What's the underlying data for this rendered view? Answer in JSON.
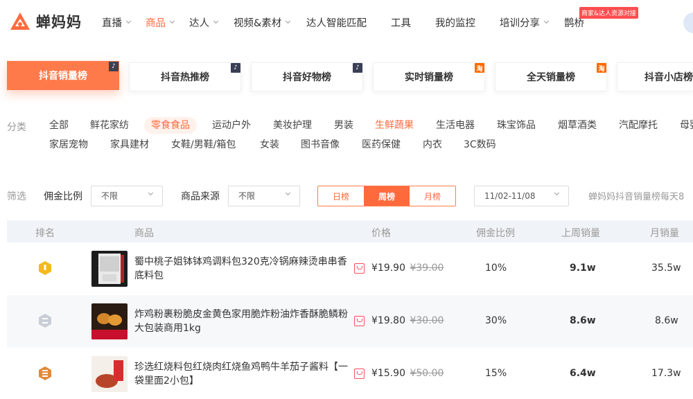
{
  "brand": {
    "name": "蝉妈妈",
    "color": "#ff6a3d"
  },
  "nav": {
    "items": [
      {
        "label": "直播",
        "dropdown": true
      },
      {
        "label": "商品",
        "dropdown": true,
        "active": true
      },
      {
        "label": "达人",
        "dropdown": true
      },
      {
        "label": "视频&素材",
        "dropdown": true
      },
      {
        "label": "达人智能匹配",
        "dropdown": false
      },
      {
        "label": "工具",
        "dropdown": false
      },
      {
        "label": "我的监控",
        "dropdown": false
      },
      {
        "label": "培训分享",
        "dropdown": true
      },
      {
        "label": "鹊桥",
        "dropdown": false
      }
    ],
    "badge": "商家&达人资源对接"
  },
  "rank_tabs": [
    {
      "label": "抖音销量榜",
      "platform": "douyin-icon",
      "active": true
    },
    {
      "label": "抖音热推榜",
      "platform": "douyin-icon"
    },
    {
      "label": "抖音好物榜",
      "platform": "douyin-icon"
    },
    {
      "label": "实时销量榜",
      "platform": "taobao-icon",
      "platform_text": "淘"
    },
    {
      "label": "全天销量榜",
      "platform": "taobao-icon",
      "platform_text": "淘"
    },
    {
      "label": "抖音小店榜",
      "platform": "none"
    }
  ],
  "categories": {
    "label": "分类",
    "items": [
      "全部",
      "鲜花家纺",
      "零食食品",
      "运动户外",
      "美妆护理",
      "男装",
      "生鲜蔬果",
      "生活电器",
      "珠宝饰品",
      "烟草酒类",
      "汽配摩托",
      "母婴",
      "家居宠物",
      "家具建材",
      "女鞋/男鞋/箱包",
      "女装",
      "图书音像",
      "医药保健",
      "内衣",
      "3C数码"
    ],
    "selected": "零食食品",
    "highlighted": "生鲜蔬果"
  },
  "filters": {
    "label": "筛选",
    "commission": {
      "label": "佣金比例",
      "value": "不限"
    },
    "source": {
      "label": "商品来源",
      "value": "不限"
    },
    "periods": [
      "日榜",
      "周榜",
      "月榜"
    ],
    "active_period": "周榜",
    "date_range": "11/02-11/08",
    "note": "蝉妈妈抖音销量榜每天8"
  },
  "table": {
    "headers": [
      "排名",
      "商品",
      "价格",
      "佣金比例",
      "上周销量",
      "月销量"
    ],
    "rows": [
      {
        "rank": 1,
        "medal": "gold",
        "name": "蜀中桃子姐钵钵鸡调料包320克冷锅麻辣烫串串香底料包",
        "price": "¥19.90",
        "old_price": "¥39.00",
        "commission": "10%",
        "last_week": "9.1w",
        "monthly": "35.5w"
      },
      {
        "rank": 2,
        "medal": "silver",
        "name": "炸鸡粉裹粉脆皮金黄色家用脆炸粉油炸香酥脆鳞粉大包装商用1kg",
        "price": "¥19.80",
        "old_price": "¥30.00",
        "commission": "30%",
        "last_week": "8.6w",
        "monthly": "8.6w"
      },
      {
        "rank": 3,
        "medal": "bronze",
        "name": "珍选红烧料包红烧肉红烧鱼鸡鸭牛羊茄子酱料【一袋里面2小包】",
        "price": "¥15.90",
        "old_price": "¥50.00",
        "commission": "15%",
        "last_week": "6.4w",
        "monthly": "17.3w"
      }
    ]
  }
}
